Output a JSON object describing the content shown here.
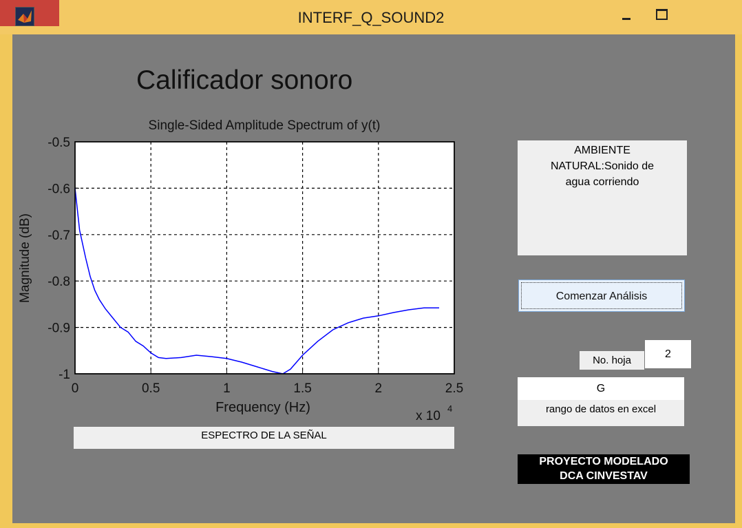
{
  "window": {
    "title": "INTERF_Q_SOUND2",
    "app_icon": "matlab-icon",
    "controls": {
      "minimize_icon": "minimize-icon",
      "maximize_icon": "maximize-icon",
      "close_label": "✕"
    }
  },
  "heading": "Calificador sonoro",
  "ambiente_text": "AMBIENTE NATURAL:Sonido de agua corriendo",
  "analyze_button": "Comenzar Análisis",
  "hoja": {
    "label": "No. hoja",
    "value": "2"
  },
  "rango": {
    "value": "G",
    "label": "rango de datos en excel"
  },
  "spectrum_label": "ESPECTRO DE LA SEÑAL",
  "project_label": {
    "line1": "PROYECTO MODELADO",
    "line2": "DCA CINVESTAV"
  },
  "colors": {
    "titlebar": "#f3c964",
    "client_bg": "#7c7c7c",
    "close_btn": "#c8423a",
    "line": "#0000ff"
  },
  "chart_data": {
    "type": "line",
    "title": "Single-Sided Amplitude Spectrum of y(t)",
    "xlabel": "Frequency (Hz)",
    "ylabel": "Magnitude (dB)",
    "x_multiplier_label": "x 10",
    "x_multiplier_exp": "4",
    "xlim": [
      0,
      2.5
    ],
    "ylim": [
      -1,
      -0.5
    ],
    "xticks": [
      0,
      0.5,
      1,
      1.5,
      2,
      2.5
    ],
    "xtick_labels": [
      "0",
      "0.5",
      "1",
      "1.5",
      "2",
      "2.5"
    ],
    "yticks": [
      -1,
      -0.9,
      -0.8,
      -0.7,
      -0.6,
      -0.5
    ],
    "ytick_labels": [
      "-1",
      "-0.9",
      "-0.8",
      "-0.7",
      "-0.6",
      "-0.5"
    ],
    "grid": true,
    "series": [
      {
        "x": [
          0,
          0.01,
          0.02,
          0.03,
          0.05,
          0.07,
          0.1,
          0.13,
          0.16,
          0.2,
          0.25,
          0.3,
          0.35,
          0.4,
          0.45,
          0.5,
          0.55,
          0.6,
          0.7,
          0.8,
          0.9,
          1.0,
          1.1,
          1.2,
          1.3,
          1.37,
          1.42,
          1.5,
          1.6,
          1.7,
          1.8,
          1.9,
          2.0,
          2.1,
          2.2,
          2.3,
          2.4
        ],
        "y": [
          -0.6,
          -0.63,
          -0.66,
          -0.69,
          -0.72,
          -0.75,
          -0.79,
          -0.82,
          -0.84,
          -0.86,
          -0.88,
          -0.9,
          -0.91,
          -0.93,
          -0.94,
          -0.955,
          -0.965,
          -0.967,
          -0.965,
          -0.96,
          -0.963,
          -0.967,
          -0.975,
          -0.985,
          -0.995,
          -1.0,
          -0.99,
          -0.96,
          -0.93,
          -0.905,
          -0.89,
          -0.88,
          -0.875,
          -0.868,
          -0.862,
          -0.858,
          -0.858
        ]
      }
    ]
  }
}
